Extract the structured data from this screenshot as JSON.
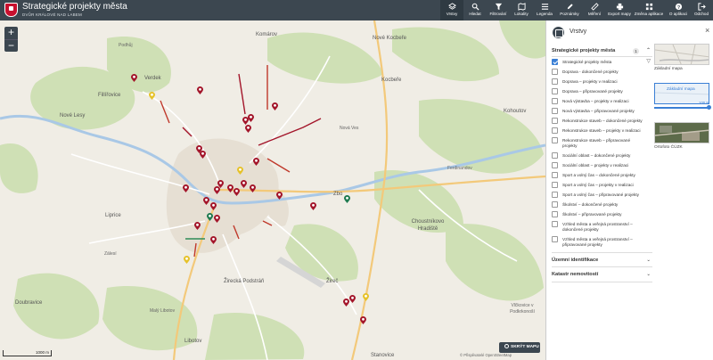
{
  "header": {
    "title": "Strategické projekty města",
    "subtitle": "DVŮR KRÁLOVÉ NAD LABEM",
    "toolbar": [
      {
        "label": "Vrstvy",
        "icon": "layers-icon",
        "active": true
      },
      {
        "label": "Hledat",
        "icon": "search-icon"
      },
      {
        "label": "Filtrování",
        "icon": "filter-icon"
      },
      {
        "label": "Lokality",
        "icon": "map-icon"
      },
      {
        "label": "Legenda",
        "icon": "list-icon"
      },
      {
        "label": "Poznámky",
        "icon": "pencil-icon"
      },
      {
        "label": "Měření",
        "icon": "ruler-icon"
      },
      {
        "label": "Export mapy",
        "icon": "print-icon"
      },
      {
        "label": "Změna aplikace",
        "icon": "apps-icon"
      },
      {
        "label": "O aplikaci",
        "icon": "help-icon"
      },
      {
        "label": "Odchod",
        "icon": "logout-icon"
      }
    ]
  },
  "map": {
    "zoom_in": "+",
    "zoom_out": "−",
    "places": [
      "Komárov",
      "Nové Kocbeře",
      "Podhůj",
      "Verdek",
      "Kocbeře",
      "Fillířovice",
      "Nové Lesy",
      "Kohoutov",
      "Nová Ves",
      "Ferdinandov",
      "Choustníkovo Hradiště",
      "Liprice",
      "Zálesí",
      "Žirecká Podstráň",
      "Žireč",
      "Doubravice",
      "Malý Libotov",
      "Libotov",
      "Vlčkovice v Podkrkonoší",
      "Stanovice",
      "Zbo"
    ],
    "scale": "1000 m",
    "attribution": "© Přispěvatelé OpenStreetMap",
    "legend_button": "SKRÝT MAPU"
  },
  "panel": {
    "title": "Vrstvy",
    "close": "×",
    "section": {
      "title": "Strategické projekty města",
      "count": "1",
      "chevron": "⌃"
    },
    "items": [
      {
        "label": "Strategické projekty města",
        "checked": true
      },
      {
        "label": "Doprava - dokončené projekty"
      },
      {
        "label": "Doprava – projekty v realizaci"
      },
      {
        "label": "Doprava – připravované projekty"
      },
      {
        "label": "Nová výstavba – projekty v realizaci"
      },
      {
        "label": "Nová výstavba – připravované projekty"
      },
      {
        "label": "Rekonstrukce staveb – dokončené projekty"
      },
      {
        "label": "Rekonstrukce staveb – projekty v realizaci"
      },
      {
        "label": "Rekonstrukce staveb – připravované projekty"
      },
      {
        "label": "Sociální oblast – dokončené projekty"
      },
      {
        "label": "Sociální oblast – projekty v realizaci"
      },
      {
        "label": "Sport a volný čas – dokončené projekty"
      },
      {
        "label": "Sport a volný čas – projekty v realizaci"
      },
      {
        "label": "Sport a volný čas – připravované projekty"
      },
      {
        "label": "Školství – dokončené projekty"
      },
      {
        "label": "Školství – připravované projekty"
      },
      {
        "label": "Vzhled města a veřejná prostranství – dokončené projekty"
      },
      {
        "label": "Vzhled města a veřejná prostranství – připravované projekty"
      }
    ],
    "other_sections": [
      {
        "title": "Územní identifikace",
        "chevron": "⌄"
      },
      {
        "title": "Katastr nemovitostí",
        "chevron": "⌄"
      }
    ],
    "basemaps": [
      {
        "label": "Základní mapa",
        "active": false
      },
      {
        "label": "Základní mapa",
        "active": true,
        "opacity": "100 %"
      },
      {
        "label": "Ortofoto ČÚZK",
        "active": false
      }
    ]
  },
  "colors": {
    "header": "#3c4750",
    "accent": "#3a7fd5",
    "marker_red": "#a3152a",
    "marker_yellow": "#e6c229",
    "marker_green": "#1e7a4f"
  }
}
